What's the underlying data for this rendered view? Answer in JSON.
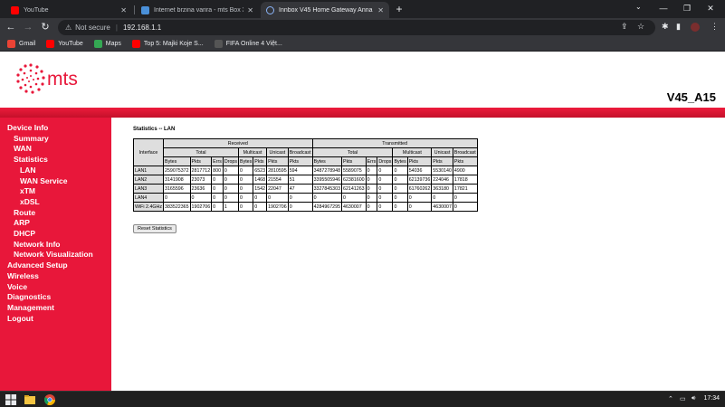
{
  "browser": {
    "tabs": [
      {
        "title": "YouTube",
        "fav_color": "#ff0000",
        "active": false
      },
      {
        "title": "Internet brzina varira - mts Box 3",
        "fav_color": "#4a90d9",
        "active": false
      },
      {
        "title": "Innbox V45 Home Gateway Anna",
        "fav_color": "#5f6368",
        "active": true
      }
    ],
    "new_tab": "+",
    "not_secure": "Not secure",
    "url": "192.168.1.1",
    "bookmarks": [
      {
        "label": "Gmail",
        "color": "#ea4335"
      },
      {
        "label": "YouTube",
        "color": "#ff0000"
      },
      {
        "label": "Maps",
        "color": "#34a853"
      },
      {
        "label": "Top 5: Majki Koje S...",
        "color": "#ff0000"
      },
      {
        "label": "FIFA Online 4 Việt...",
        "color": "#1a1a1a"
      }
    ]
  },
  "header": {
    "logo_text": "mts",
    "model": "V45_A15",
    "brand_color": "#e8173a"
  },
  "sidebar": {
    "items": [
      {
        "label": "Device Info",
        "level": 0
      },
      {
        "label": "Summary",
        "level": 1
      },
      {
        "label": "WAN",
        "level": 1
      },
      {
        "label": "Statistics",
        "level": 1
      },
      {
        "label": "LAN",
        "level": 2
      },
      {
        "label": "WAN Service",
        "level": 2
      },
      {
        "label": "xTM",
        "level": 2
      },
      {
        "label": "xDSL",
        "level": 2
      },
      {
        "label": "Route",
        "level": 1
      },
      {
        "label": "ARP",
        "level": 1
      },
      {
        "label": "DHCP",
        "level": 1
      },
      {
        "label": "Network Info",
        "level": 1
      },
      {
        "label": "Network Visualization",
        "level": 1
      },
      {
        "label": "Advanced Setup",
        "level": 0
      },
      {
        "label": "Wireless",
        "level": 0
      },
      {
        "label": "Voice",
        "level": 0
      },
      {
        "label": "Diagnostics",
        "level": 0
      },
      {
        "label": "Management",
        "level": 0
      },
      {
        "label": "Logout",
        "level": 0
      }
    ]
  },
  "content": {
    "title": "Statistics -- LAN",
    "table": {
      "interface_header": "Interface",
      "received": "Received",
      "transmitted": "Transmitted",
      "total": "Total",
      "multicast": "Multicast",
      "unicast": "Unicast",
      "broadcast": "Broadcast",
      "sub_headers": [
        "Bytes",
        "Pkts",
        "Errs",
        "Drops",
        "Bytes",
        "Pkts",
        "Pkts",
        "Pkts",
        "Bytes",
        "Pkts",
        "Errs",
        "Drops",
        "Bytes",
        "Pkts",
        "Pkts",
        "Pkts"
      ],
      "rows": [
        [
          "LAN1",
          "259075372",
          "2817712",
          "800",
          "0",
          "0",
          "6523",
          "2810595",
          "594",
          "3487278948",
          "5589075",
          "0",
          "0",
          "0",
          "54036",
          "5530140",
          "4900"
        ],
        [
          "LAN2",
          "3141908",
          "23073",
          "0",
          "0",
          "0",
          "1468",
          "21554",
          "51",
          "3395505946",
          "62381600",
          "0",
          "0",
          "0",
          "62139736",
          "224046",
          "17818"
        ],
        [
          "LAN3",
          "3165596",
          "23636",
          "0",
          "0",
          "0",
          "1542",
          "22047",
          "47",
          "3327845303",
          "62141263",
          "0",
          "0",
          "0",
          "61760262",
          "363180",
          "17821"
        ],
        [
          "LAN4",
          "0",
          "0",
          "0",
          "0",
          "0",
          "0",
          "0",
          "0",
          "0",
          "0",
          "0",
          "0",
          "0",
          "0",
          "0",
          "0"
        ],
        [
          "WiFi 2.4GHz",
          "383522365",
          "1902706",
          "0",
          "1",
          "0",
          "0",
          "1902706",
          "0",
          "4284967295",
          "4630007",
          "0",
          "0",
          "0",
          "0",
          "4630007",
          "0"
        ]
      ]
    },
    "reset_button": "Reset Statistics"
  },
  "taskbar": {
    "time": "17:34"
  }
}
